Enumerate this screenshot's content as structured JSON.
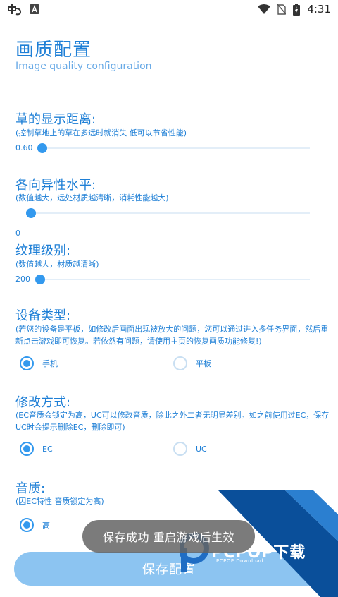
{
  "status_bar": {
    "time": "4:31",
    "icons": [
      "app-logo-icon",
      "a-notification-icon",
      "wifi-icon",
      "no-sim-icon",
      "battery-charging-icon"
    ]
  },
  "header": {
    "title": "画质配置",
    "subtitle": "Image quality configuration"
  },
  "grass": {
    "title": "草的显示距离:",
    "desc": "(控制草地上的草在多远时就消失 低可以节省性能)",
    "value": "0.60",
    "fraction": 0.0
  },
  "aniso": {
    "title": "各向异性水平:",
    "desc": "(数值越大，远处材质越清晰，消耗性能越大)",
    "value": "0",
    "fraction": 0.0
  },
  "texture": {
    "title": "纹理级别:",
    "desc": "(数值越大，材质越清晰)",
    "value": "200",
    "fraction": 0.0
  },
  "device": {
    "title": "设备类型:",
    "desc": "(若您的设备是平板，如修改后画面出现被放大的问题，您可以通过进入多任务界面，然后重新点击游戏即可恢复。若依然有问题，请使用主页的恢复画质功能修复!)",
    "options": [
      "手机",
      "平板"
    ],
    "selected": 0
  },
  "mode": {
    "title": "修改方式:",
    "desc": "(EC音质会锁定为高，UC可以修改音质，除此之外二者无明显差别。如之前使用过EC，保存UC时会提示删除EC，删除即可)",
    "options": [
      "EC",
      "UC"
    ],
    "selected": 0
  },
  "sound": {
    "title": "音质:",
    "desc": "(因EC特性 音质锁定为高)",
    "options": [
      "高"
    ],
    "selected": 0
  },
  "save_button": {
    "label": "保存配置"
  },
  "toast": {
    "text": "保存成功 重启游戏后生效"
  },
  "watermark": {
    "text": "PCPOP下载",
    "sub": "PCPOP Download"
  },
  "colors": {
    "accent": "#3399ee",
    "text": "#1e7fd6",
    "button": "#8cc4f1",
    "toast_bg": "#646464",
    "watermark_blue": "#0a4f9a"
  }
}
